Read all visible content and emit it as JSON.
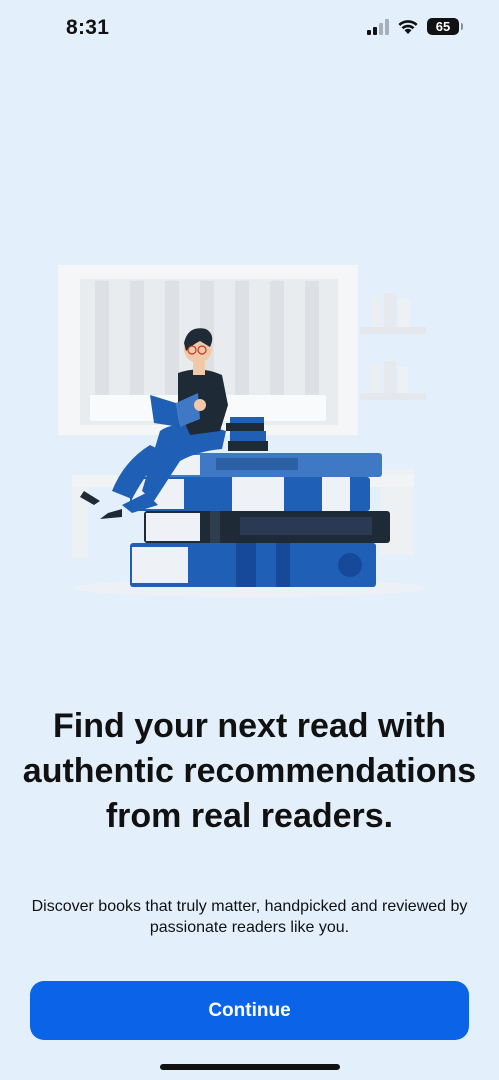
{
  "status_bar": {
    "time": "8:31",
    "battery_level": "65",
    "icons": [
      "signal-icon",
      "wifi-icon",
      "battery-icon"
    ]
  },
  "illustration": {
    "icon": "person-reading-on-books-illustration",
    "colors": {
      "primary_blue": "#1f5fb5",
      "dark": "#1e2a36",
      "background_panel": "#f2f4f6"
    }
  },
  "onboarding": {
    "headline": "Find your next read with authentic recommendations from real readers.",
    "subtext": "Discover books that truly matter, handpicked and reviewed by passionate readers like you.",
    "continue_label": "Continue"
  },
  "theme": {
    "background": "#e3f0fc",
    "accent": "#0b63e8"
  }
}
